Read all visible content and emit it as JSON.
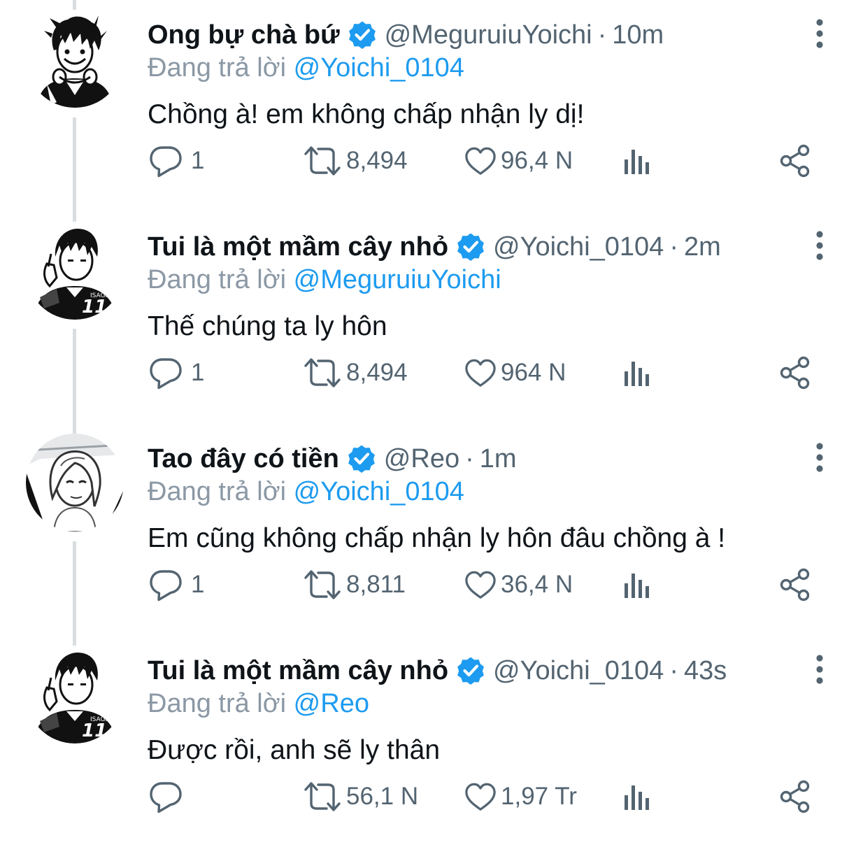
{
  "colors": {
    "text": "#0f1419",
    "secondary": "#536471",
    "reply_prefix": "#8b98a5",
    "mention": "#1d9bf0",
    "verified": "#1d9bf0",
    "thread_line": "#d9dde0"
  },
  "tweets": [
    {
      "display_name": "Ong bự chà bứ",
      "handle": "@MeguruiuYoichi",
      "dot": "·",
      "time": "10m",
      "reply_prefix": "Đang trả lời",
      "reply_to": "@Yoichi_0104",
      "text": "Chồng à! em không chấp nhận ly dị!",
      "reply_count": "1",
      "retweet_count": "8,494",
      "like_count": "96,4 N",
      "avatar": "avatar-bachira-headphones",
      "verified": true
    },
    {
      "display_name": "Tui là một mầm cây nhỏ",
      "handle": "@Yoichi_0104",
      "dot": "·",
      "time": "2m",
      "reply_prefix": "Đang trả lời",
      "reply_to": "@MeguruiuYoichi",
      "text": "Thế chúng ta ly hôn",
      "reply_count": "1",
      "retweet_count": "8,494",
      "like_count": "964 N",
      "avatar": "avatar-isagi-jersey-11",
      "verified": true
    },
    {
      "display_name": "Tao đây có tiền",
      "handle": "@Reo",
      "dot": "·",
      "time": "1m",
      "reply_prefix": "Đang trả lời",
      "reply_to": "@Yoichi_0104",
      "text": "Em cũng không chấp nhận ly hôn đâu chồng à !",
      "reply_count": "1",
      "retweet_count": "8,811",
      "like_count": "36,4 N",
      "avatar": "avatar-reo",
      "verified": true
    },
    {
      "display_name": "Tui là một mầm cây nhỏ",
      "handle": "@Yoichi_0104",
      "dot": "·",
      "time": "43s",
      "reply_prefix": "Đang trả lời",
      "reply_to": "@Reo",
      "text": "Được rồi, anh sẽ ly thân",
      "reply_count": "",
      "retweet_count": "56,1 N",
      "like_count": "1,97 Tr",
      "avatar": "avatar-isagi-jersey-11",
      "verified": true
    }
  ],
  "icons": {
    "reply": "reply-icon",
    "retweet": "retweet-icon",
    "like": "heart-icon",
    "views": "views-icon",
    "share": "share-icon",
    "more": "more-vertical-icon",
    "verified": "verified-badge-icon"
  }
}
